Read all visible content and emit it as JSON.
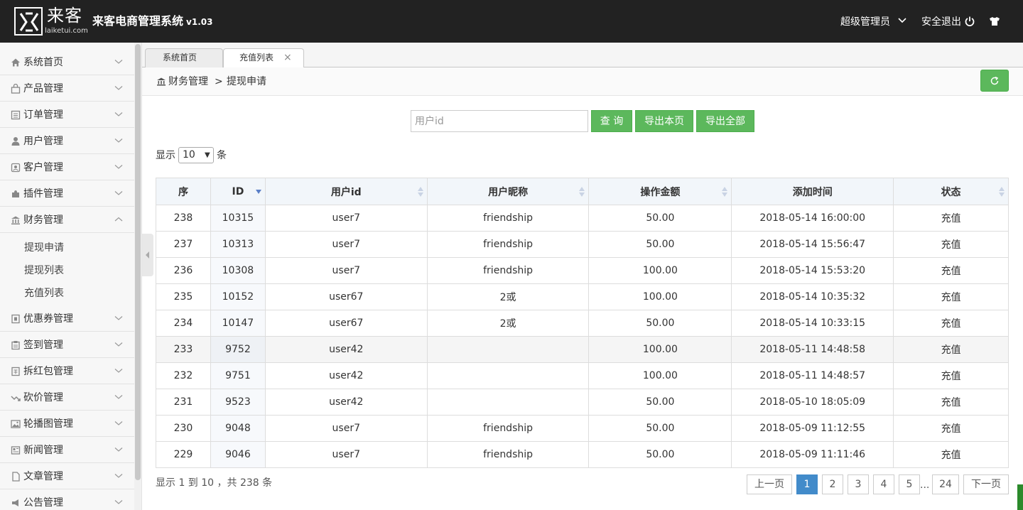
{
  "header": {
    "logo_cn": "来客",
    "logo_en": "laiketui.com",
    "title": "来客电商管理系统",
    "version": "v1.03",
    "user": "超级管理员",
    "logout": "安全退出"
  },
  "sidebar": {
    "items": [
      {
        "label": "系统首页",
        "icon": "home-icon"
      },
      {
        "label": "产品管理",
        "icon": "bag-icon"
      },
      {
        "label": "订单管理",
        "icon": "list-icon"
      },
      {
        "label": "用户管理",
        "icon": "user-icon"
      },
      {
        "label": "客户管理",
        "icon": "customer-icon"
      },
      {
        "label": "插件管理",
        "icon": "puzzle-icon"
      },
      {
        "label": "财务管理",
        "icon": "bank-icon"
      },
      {
        "label": "优惠券管理",
        "icon": "coupon-icon"
      },
      {
        "label": "签到管理",
        "icon": "signin-icon"
      },
      {
        "label": "拆红包管理",
        "icon": "redpacket-icon"
      },
      {
        "label": "砍价管理",
        "icon": "bargain-icon"
      },
      {
        "label": "轮播图管理",
        "icon": "image-icon"
      },
      {
        "label": "新闻管理",
        "icon": "news-icon"
      },
      {
        "label": "文章管理",
        "icon": "article-icon"
      },
      {
        "label": "公告管理",
        "icon": "notice-icon"
      }
    ],
    "sub_items": [
      "提现申请",
      "提现列表",
      "充值列表"
    ]
  },
  "tabs": {
    "t1": "系统首页",
    "t2": "充值列表"
  },
  "breadcrumb": {
    "section": "财务管理",
    "separator": ">",
    "page": "提现申请"
  },
  "search": {
    "placeholder": "用户id",
    "query_btn": "查 询",
    "export_page_btn": "导出本页",
    "export_all_btn": "导出全部"
  },
  "length": {
    "prefix": "显示",
    "value": "10",
    "suffix": "条"
  },
  "table": {
    "headers": [
      "序",
      "ID",
      "用户id",
      "用户昵称",
      "操作金额",
      "添加时间",
      "状态"
    ],
    "rows": [
      [
        "238",
        "10315",
        "user7",
        "friendship",
        "50.00",
        "2018-05-14 16:00:00",
        "充值"
      ],
      [
        "237",
        "10313",
        "user7",
        "friendship",
        "50.00",
        "2018-05-14 15:56:47",
        "充值"
      ],
      [
        "236",
        "10308",
        "user7",
        "friendship",
        "100.00",
        "2018-05-14 15:53:20",
        "充值"
      ],
      [
        "235",
        "10152",
        "user67",
        "2或",
        "100.00",
        "2018-05-14 10:35:32",
        "充值"
      ],
      [
        "234",
        "10147",
        "user67",
        "2或",
        "50.00",
        "2018-05-14 10:33:15",
        "充值"
      ],
      [
        "233",
        "9752",
        "user42",
        "",
        "100.00",
        "2018-05-11 14:48:58",
        "充值"
      ],
      [
        "232",
        "9751",
        "user42",
        "",
        "100.00",
        "2018-05-11 14:48:57",
        "充值"
      ],
      [
        "231",
        "9523",
        "user42",
        "",
        "50.00",
        "2018-05-10 18:05:09",
        "充值"
      ],
      [
        "230",
        "9048",
        "user7",
        "friendship",
        "50.00",
        "2018-05-09 11:12:55",
        "充值"
      ],
      [
        "229",
        "9046",
        "user7",
        "friendship",
        "50.00",
        "2018-05-09 11:11:46",
        "充值"
      ]
    ]
  },
  "footer": {
    "info": "显示 1 到 10 ，共 238 条",
    "prev": "上一页",
    "pages": [
      "1",
      "2",
      "3",
      "4",
      "5"
    ],
    "dots": "...",
    "last": "24",
    "next": "下一页",
    "current_page": "1"
  },
  "colors": {
    "topbar": "#222222",
    "primary_green": "#5cb85c",
    "active_page": "#428bca"
  }
}
